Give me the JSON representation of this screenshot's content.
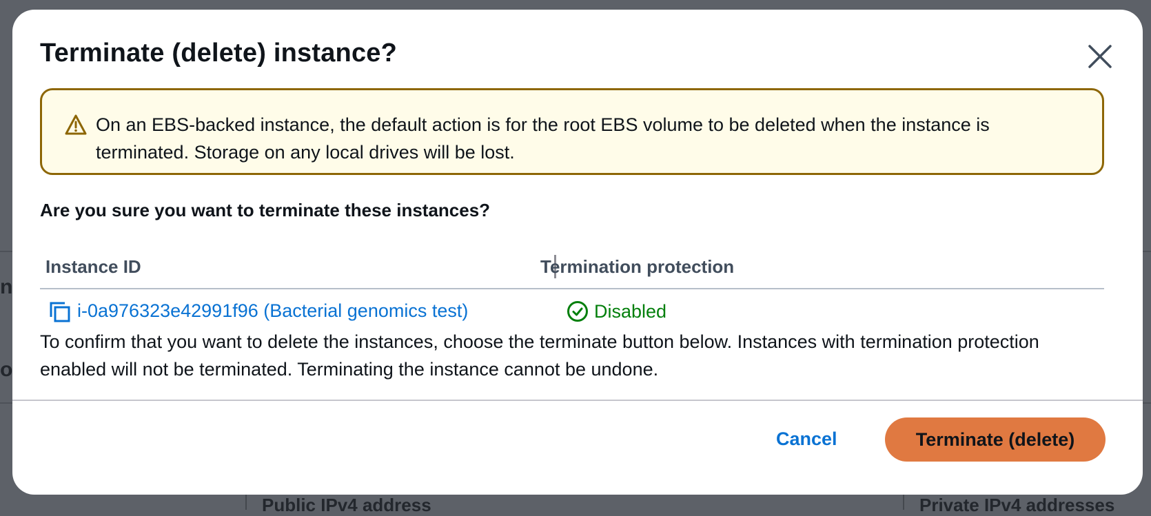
{
  "background": {
    "labels": [
      "Public IPv4 address",
      "Private IPv4 addresses"
    ]
  },
  "dialog": {
    "title": "Terminate (delete) instance?",
    "close_icon": "close-icon",
    "warning": {
      "icon": "warning-icon",
      "text": "On an EBS-backed instance, the default action is for the root EBS volume to be deleted when the instance is terminated. Storage on any local drives will be lost."
    },
    "question": "Are you sure you want to terminate these instances?",
    "table": {
      "columns": [
        "Instance ID",
        "Termination protection"
      ],
      "rows": [
        {
          "instance": "i-0a976323e42991f96 (Bacterial genomics test)",
          "protection": "Disabled",
          "copy_icon": "copy-icon",
          "status_icon": "check-circle-icon"
        }
      ]
    },
    "confirm_text": "To confirm that you want to delete the instances, choose the terminate button below. Instances with termination protection enabled will not be terminated. Terminating the instance cannot be undone.",
    "buttons": {
      "cancel": "Cancel",
      "terminate": "Terminate (delete)"
    }
  },
  "colors": {
    "link": "#0972d3",
    "success": "#037f0c",
    "warning_border": "#8d6605",
    "warning_bg": "#fffce9",
    "primary_button": "#e07941"
  }
}
